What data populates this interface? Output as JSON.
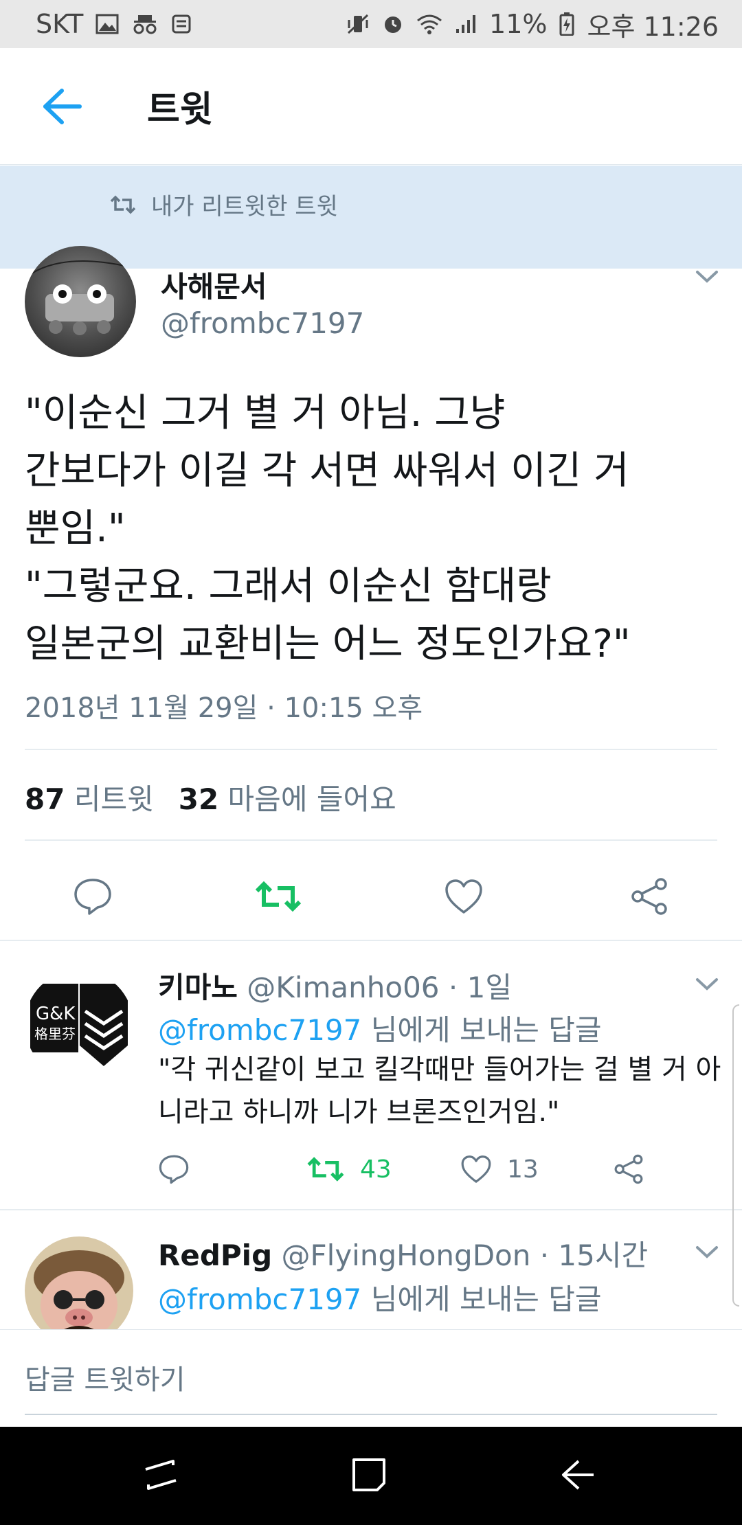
{
  "status_bar": {
    "carrier": "SKT",
    "battery": "11%",
    "time": "오후 11:26"
  },
  "header": {
    "title": "트윗"
  },
  "retweet_banner": {
    "label": "내가 리트윗한 트윗"
  },
  "tweet": {
    "name": "사해문서",
    "handle": "@frombc7197",
    "text": "\"이순신 그거 별 거 아님. 그냥\n간보다가 이길 각 서면 싸워서 이긴 거\n뿐임.\"\n\"그렇군요. 그래서 이순신 함대랑\n일본군의 교환비는 어느 정도인가요?\"",
    "timestamp": "2018년 11월 29일 · 10:15 오후",
    "retweet_count": "87",
    "retweet_label": "리트윗",
    "like_count": "32",
    "like_label": "마음에 들어요"
  },
  "replies": [
    {
      "name": "키마노",
      "handle": "@Kimanho06",
      "time": "· 1일",
      "reply_to_mention": "@frombc7197",
      "reply_to_suffix": " 님에게 보내는 답글",
      "text": "\"각 귀신같이 보고 킬각때만 들어가는 걸 별 거 아니라고 하니까 니가 브론즈인거임.\"",
      "retweets": "43",
      "likes": "13"
    },
    {
      "name": "RedPig",
      "handle": "@FlyingHongDon",
      "time": "· 15시간",
      "reply_to_mention": "@frombc7197",
      "reply_to_suffix": " 님에게 보내는 답글"
    }
  ],
  "composer": {
    "placeholder": "답글 트윗하기"
  },
  "colors": {
    "accent": "#1da1f2",
    "retweet_green": "#17bf63",
    "secondary_text": "#657786",
    "banner_bg": "#dbe9f6"
  }
}
